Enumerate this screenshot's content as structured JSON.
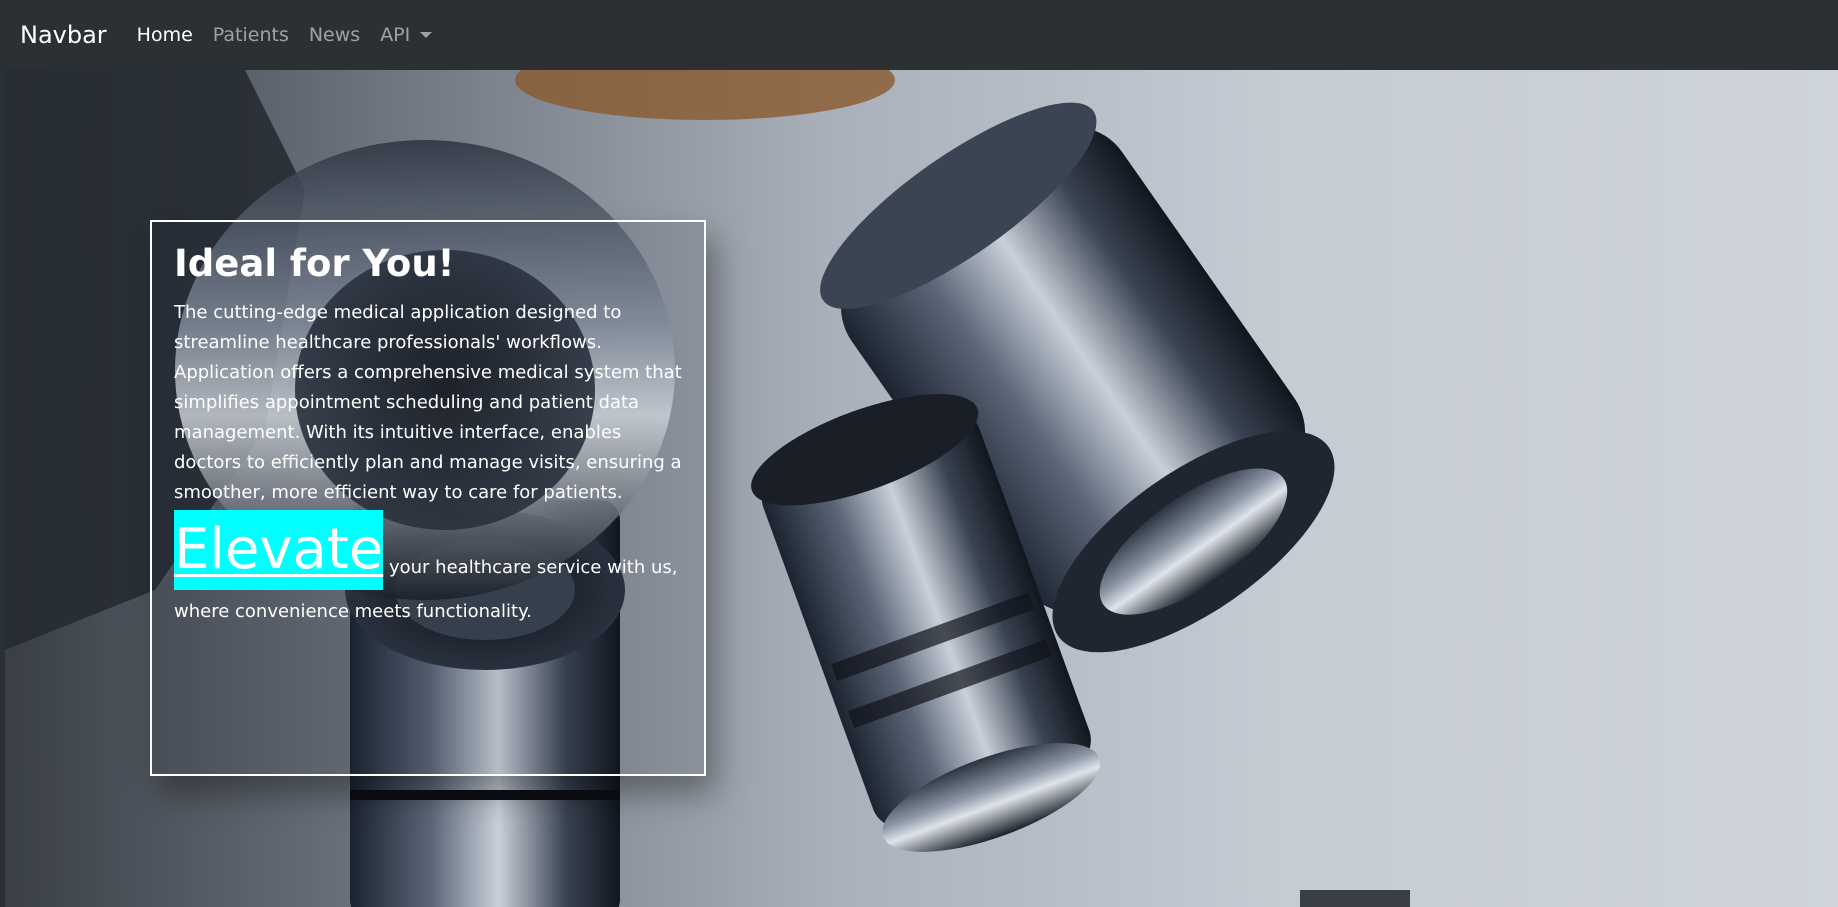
{
  "navbar": {
    "brand": "Navbar",
    "links": [
      {
        "label": "Home",
        "active": true
      },
      {
        "label": "Patients",
        "active": false
      },
      {
        "label": "News",
        "active": false
      },
      {
        "label": "API",
        "active": false,
        "dropdown": true
      }
    ],
    "background": "#2b3035"
  },
  "hero": {
    "background_image": "microscope-photo",
    "card": {
      "title": "Ideal for You!",
      "description": "The cutting-edge medical application designed to streamline healthcare professionals' workflows. Application offers a comprehensive medical system that simplifies appointment scheduling and patient data management. With its intuitive interface, enables doctors to efficiently plan and manage visits, ensuring a smoother, more efficient way to care for patients.",
      "highlight_word": "Elevate",
      "tagline_rest": " your healthcare service with us, where convenience meets functionality.",
      "highlight_color": "#00ffff"
    }
  }
}
